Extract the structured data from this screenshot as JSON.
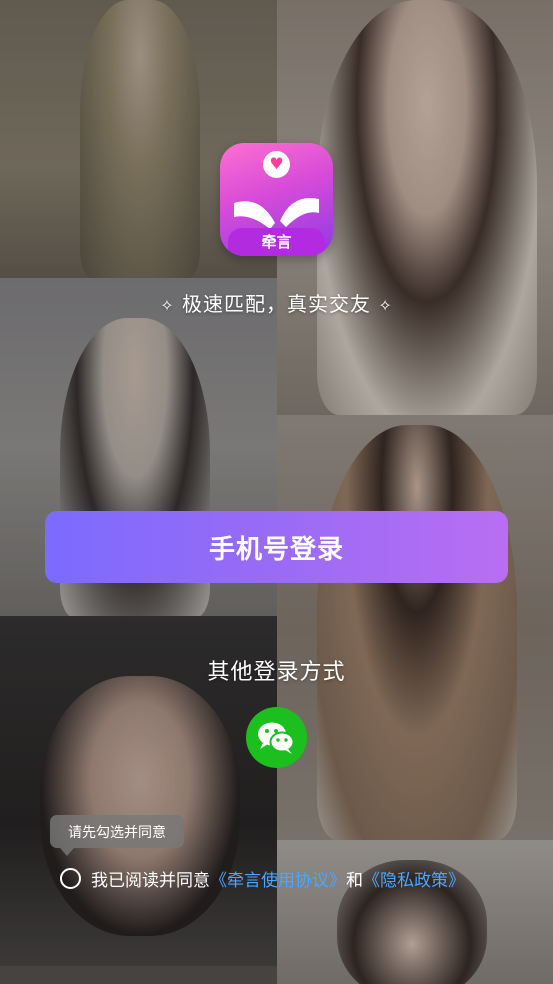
{
  "app": {
    "logo_text": "牵言"
  },
  "slogan": {
    "text": "极速匹配，真实交友"
  },
  "login": {
    "phone_button": "手机号登录",
    "other_methods": "其他登录方式"
  },
  "tooltip": {
    "text": "请先勾选并同意"
  },
  "agreement": {
    "prefix": "我已阅读并同意",
    "user_agreement": "《牵言使用协议》",
    "and": "和",
    "privacy_policy": "《隐私政策》"
  },
  "colors": {
    "primary_button_start": "#7b6bff",
    "primary_button_end": "#b86ef3",
    "wechat_green": "#1bbf1e",
    "link_blue": "#4aa6ff"
  },
  "icons": {
    "logo": "hands-heart-icon",
    "wechat": "wechat-icon",
    "sparkle": "sparkle-icon"
  }
}
